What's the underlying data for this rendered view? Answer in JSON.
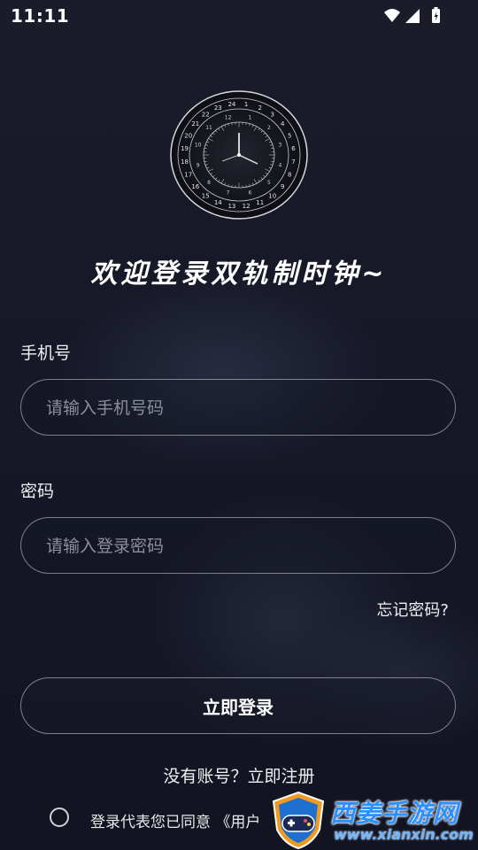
{
  "status_bar": {
    "time": "11:11",
    "icons": [
      "wifi-icon",
      "cellular-signal-icon",
      "battery-charging-icon"
    ]
  },
  "logo": {
    "icon": "dual-track-clock-logo",
    "outer_ring": [
      "1",
      "2",
      "3",
      "4",
      "5",
      "6",
      "7",
      "8",
      "9",
      "10",
      "11",
      "12",
      "13",
      "14",
      "15",
      "16",
      "17",
      "18",
      "19",
      "20",
      "21",
      "22",
      "23",
      "24"
    ],
    "inner_ring": [
      "1",
      "2",
      "3",
      "4",
      "5",
      "6",
      "7",
      "8",
      "9",
      "10",
      "11",
      "12"
    ]
  },
  "welcome_text": "欢迎登录双轨制时钟~",
  "phone": {
    "label": "手机号",
    "placeholder": "请输入手机号码",
    "value": ""
  },
  "password": {
    "label": "密码",
    "placeholder": "请输入登录密码",
    "value": ""
  },
  "forgot_password": "忘记密码?",
  "login_button": "立即登录",
  "register_link": "没有账号？立即注册",
  "agreement": {
    "checked": false,
    "text": "登录代表您已同意 《用户"
  },
  "watermark": {
    "title": "西姜手游网",
    "url": "www.xianxin.com",
    "icon": "gamepad-shield-icon"
  },
  "colors": {
    "background": "#161828",
    "watermark_blue": "#2a8fff"
  }
}
